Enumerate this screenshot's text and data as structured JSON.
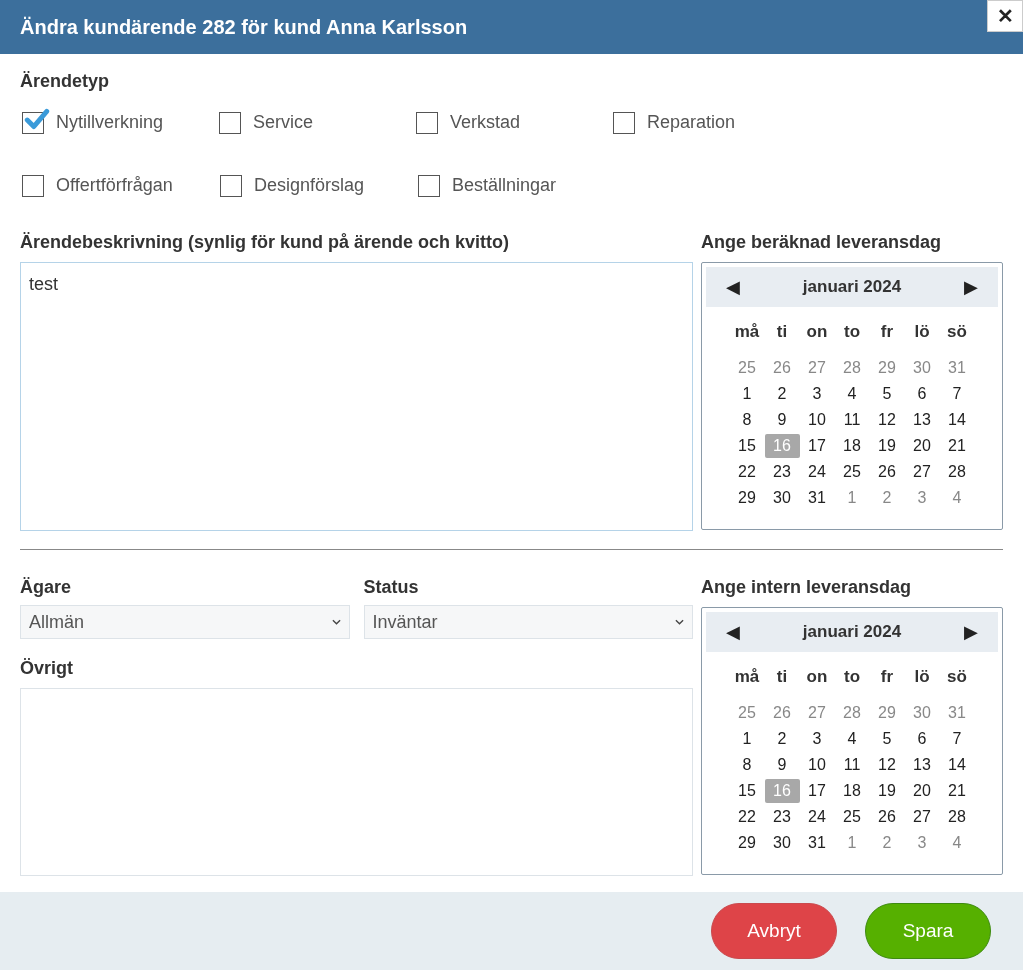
{
  "dialog": {
    "title": "Ändra kundärende 282 för kund Anna Karlsson",
    "close": "✕"
  },
  "case_type": {
    "label": "Ärendetyp",
    "rows": [
      [
        {
          "label": "Nytillverkning",
          "checked": true
        },
        {
          "label": "Service",
          "checked": false
        },
        {
          "label": "Verkstad",
          "checked": false
        },
        {
          "label": "Reparation",
          "checked": false
        }
      ],
      [
        {
          "label": "Offertförfrågan",
          "checked": false
        },
        {
          "label": "Designförslag",
          "checked": false
        },
        {
          "label": "Beställningar",
          "checked": false
        }
      ]
    ]
  },
  "description": {
    "label": "Ärendebeskrivning (synlig för kund på ärende och kvitto)",
    "value": "test"
  },
  "calendars": [
    {
      "label": "Ange beräknad leveransdag",
      "month": "januari 2024",
      "prev": "◀",
      "next": "▶",
      "weekdays": [
        "må",
        "ti",
        "on",
        "to",
        "fr",
        "lö",
        "sö"
      ],
      "days": [
        {
          "day": "25",
          "outside": true,
          "selected": false
        },
        {
          "day": "26",
          "outside": true,
          "selected": false
        },
        {
          "day": "27",
          "outside": true,
          "selected": false
        },
        {
          "day": "28",
          "outside": true,
          "selected": false
        },
        {
          "day": "29",
          "outside": true,
          "selected": false
        },
        {
          "day": "30",
          "outside": true,
          "selected": false
        },
        {
          "day": "31",
          "outside": true,
          "selected": false
        },
        {
          "day": "1",
          "outside": false,
          "selected": false
        },
        {
          "day": "2",
          "outside": false,
          "selected": false
        },
        {
          "day": "3",
          "outside": false,
          "selected": false
        },
        {
          "day": "4",
          "outside": false,
          "selected": false
        },
        {
          "day": "5",
          "outside": false,
          "selected": false
        },
        {
          "day": "6",
          "outside": false,
          "selected": false
        },
        {
          "day": "7",
          "outside": false,
          "selected": false
        },
        {
          "day": "8",
          "outside": false,
          "selected": false
        },
        {
          "day": "9",
          "outside": false,
          "selected": false
        },
        {
          "day": "10",
          "outside": false,
          "selected": false
        },
        {
          "day": "11",
          "outside": false,
          "selected": false
        },
        {
          "day": "12",
          "outside": false,
          "selected": false
        },
        {
          "day": "13",
          "outside": false,
          "selected": false
        },
        {
          "day": "14",
          "outside": false,
          "selected": false
        },
        {
          "day": "15",
          "outside": false,
          "selected": false
        },
        {
          "day": "16",
          "outside": false,
          "selected": true
        },
        {
          "day": "17",
          "outside": false,
          "selected": false
        },
        {
          "day": "18",
          "outside": false,
          "selected": false
        },
        {
          "day": "19",
          "outside": false,
          "selected": false
        },
        {
          "day": "20",
          "outside": false,
          "selected": false
        },
        {
          "day": "21",
          "outside": false,
          "selected": false
        },
        {
          "day": "22",
          "outside": false,
          "selected": false
        },
        {
          "day": "23",
          "outside": false,
          "selected": false
        },
        {
          "day": "24",
          "outside": false,
          "selected": false
        },
        {
          "day": "25",
          "outside": false,
          "selected": false
        },
        {
          "day": "26",
          "outside": false,
          "selected": false
        },
        {
          "day": "27",
          "outside": false,
          "selected": false
        },
        {
          "day": "28",
          "outside": false,
          "selected": false
        },
        {
          "day": "29",
          "outside": false,
          "selected": false
        },
        {
          "day": "30",
          "outside": false,
          "selected": false
        },
        {
          "day": "31",
          "outside": false,
          "selected": false
        },
        {
          "day": "1",
          "outside": true,
          "selected": false
        },
        {
          "day": "2",
          "outside": true,
          "selected": false
        },
        {
          "day": "3",
          "outside": true,
          "selected": false
        },
        {
          "day": "4",
          "outside": true,
          "selected": false
        }
      ]
    },
    {
      "label": "Ange intern leveransdag",
      "month": "januari 2024",
      "prev": "◀",
      "next": "▶",
      "weekdays": [
        "må",
        "ti",
        "on",
        "to",
        "fr",
        "lö",
        "sö"
      ],
      "days": [
        {
          "day": "25",
          "outside": true,
          "selected": false
        },
        {
          "day": "26",
          "outside": true,
          "selected": false
        },
        {
          "day": "27",
          "outside": true,
          "selected": false
        },
        {
          "day": "28",
          "outside": true,
          "selected": false
        },
        {
          "day": "29",
          "outside": true,
          "selected": false
        },
        {
          "day": "30",
          "outside": true,
          "selected": false
        },
        {
          "day": "31",
          "outside": true,
          "selected": false
        },
        {
          "day": "1",
          "outside": false,
          "selected": false
        },
        {
          "day": "2",
          "outside": false,
          "selected": false
        },
        {
          "day": "3",
          "outside": false,
          "selected": false
        },
        {
          "day": "4",
          "outside": false,
          "selected": false
        },
        {
          "day": "5",
          "outside": false,
          "selected": false
        },
        {
          "day": "6",
          "outside": false,
          "selected": false
        },
        {
          "day": "7",
          "outside": false,
          "selected": false
        },
        {
          "day": "8",
          "outside": false,
          "selected": false
        },
        {
          "day": "9",
          "outside": false,
          "selected": false
        },
        {
          "day": "10",
          "outside": false,
          "selected": false
        },
        {
          "day": "11",
          "outside": false,
          "selected": false
        },
        {
          "day": "12",
          "outside": false,
          "selected": false
        },
        {
          "day": "13",
          "outside": false,
          "selected": false
        },
        {
          "day": "14",
          "outside": false,
          "selected": false
        },
        {
          "day": "15",
          "outside": false,
          "selected": false
        },
        {
          "day": "16",
          "outside": false,
          "selected": true
        },
        {
          "day": "17",
          "outside": false,
          "selected": false
        },
        {
          "day": "18",
          "outside": false,
          "selected": false
        },
        {
          "day": "19",
          "outside": false,
          "selected": false
        },
        {
          "day": "20",
          "outside": false,
          "selected": false
        },
        {
          "day": "21",
          "outside": false,
          "selected": false
        },
        {
          "day": "22",
          "outside": false,
          "selected": false
        },
        {
          "day": "23",
          "outside": false,
          "selected": false
        },
        {
          "day": "24",
          "outside": false,
          "selected": false
        },
        {
          "day": "25",
          "outside": false,
          "selected": false
        },
        {
          "day": "26",
          "outside": false,
          "selected": false
        },
        {
          "day": "27",
          "outside": false,
          "selected": false
        },
        {
          "day": "28",
          "outside": false,
          "selected": false
        },
        {
          "day": "29",
          "outside": false,
          "selected": false
        },
        {
          "day": "30",
          "outside": false,
          "selected": false
        },
        {
          "day": "31",
          "outside": false,
          "selected": false
        },
        {
          "day": "1",
          "outside": true,
          "selected": false
        },
        {
          "day": "2",
          "outside": true,
          "selected": false
        },
        {
          "day": "3",
          "outside": true,
          "selected": false
        },
        {
          "day": "4",
          "outside": true,
          "selected": false
        }
      ]
    }
  ],
  "owner": {
    "label": "Ägare",
    "value": "Allmän"
  },
  "status": {
    "label": "Status",
    "value": "Inväntar"
  },
  "other": {
    "label": "Övrigt"
  },
  "buttons": [
    {
      "kind": "cancel",
      "label": "Avbryt"
    },
    {
      "kind": "save",
      "label": "Spara"
    }
  ]
}
